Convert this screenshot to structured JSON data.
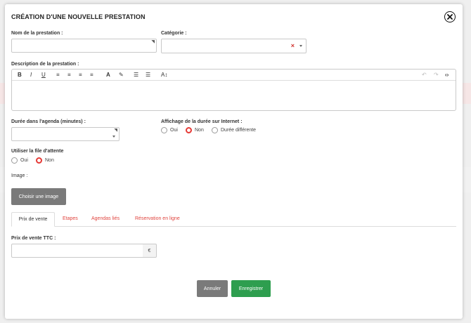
{
  "modal": {
    "title": "CRÉATION D'UNE NOUVELLE PRESTATION"
  },
  "fields": {
    "name_label": "Nom de la prestation :",
    "name_value": "",
    "category_label": "Catégorie :",
    "category_value": "",
    "description_label": "Description de la prestation :",
    "duration_label": "Durée dans l'agenda (minutes) :",
    "duration_value": "",
    "internet_display_label": "Affichage de la durée sur Internet :",
    "internet_display_options": [
      "Oui",
      "Non",
      "Durée différente"
    ],
    "internet_display_selected": "Non",
    "queue_label": "Utiliser la file d'attente",
    "queue_options": [
      "Oui",
      "Non"
    ],
    "queue_selected": "Non",
    "image_label": "Image :",
    "image_button": "Choisir une image"
  },
  "editor_toolbar": [
    "B",
    "I",
    "U",
    "align-left-icon",
    "align-center-icon",
    "align-right-icon",
    "align-justify-icon",
    "text-color-icon",
    "highlight-icon",
    "bullet-list-icon",
    "numbered-list-icon",
    "font-size-icon",
    "undo-icon",
    "redo-icon",
    "code-icon"
  ],
  "tabs": {
    "items": [
      "Prix de vente",
      "Etapes",
      "Agendas liés",
      "Réservation en ligne"
    ],
    "active": "Prix de vente"
  },
  "price": {
    "label": "Prix de vente TTC :",
    "value": "",
    "currency": "€"
  },
  "actions": {
    "cancel": "Annuler",
    "save": "Enregistrer"
  },
  "colors": {
    "accent_red": "#e53935",
    "save_green": "#2e9e4f",
    "neutral_button": "#7a7a7a"
  }
}
